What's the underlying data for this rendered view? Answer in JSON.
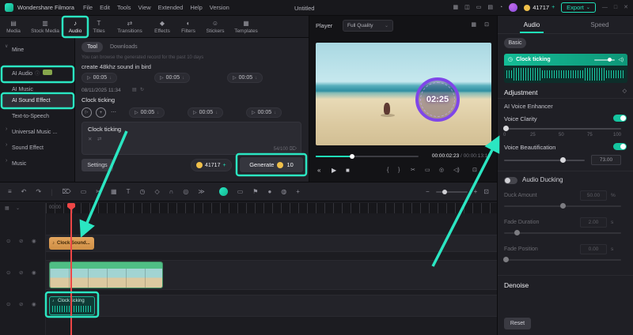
{
  "menubar": {
    "app": "Wondershare Filmora",
    "menus": [
      {
        "label": "File"
      },
      {
        "label": "Edit"
      },
      {
        "label": "Tools"
      },
      {
        "label": "View"
      },
      {
        "label": "Extended"
      },
      {
        "label": "Help"
      },
      {
        "label": "Version"
      }
    ],
    "title": "Untitled",
    "coins": "41717",
    "export_label": "Export"
  },
  "media_tabs": {
    "items": [
      {
        "label": "Media",
        "icon": "▤"
      },
      {
        "label": "Stock Media",
        "icon": "▥"
      },
      {
        "label": "Audio",
        "icon": "♪"
      },
      {
        "label": "Titles",
        "icon": "T"
      },
      {
        "label": "Transitions",
        "icon": "⇄"
      },
      {
        "label": "Effects",
        "icon": "◆"
      },
      {
        "label": "Filters",
        "icon": "◐"
      },
      {
        "label": "Stickers",
        "icon": "☺"
      },
      {
        "label": "Templates",
        "icon": "▦"
      }
    ]
  },
  "sidebar": {
    "items": [
      {
        "label": "Mine",
        "chevron": "∨"
      },
      {
        "label": "AI Audio",
        "chevron": ""
      },
      {
        "label": "AI Music",
        "chevron": ""
      },
      {
        "label": "AI Sound Effect",
        "chevron": ""
      },
      {
        "label": "Text-to-Speech",
        "chevron": ""
      },
      {
        "label": "Universal Music ...",
        "chevron": "›"
      },
      {
        "label": "Sound Effect",
        "chevron": "›"
      },
      {
        "label": "Music",
        "chevron": "›"
      }
    ]
  },
  "generator": {
    "tab_tool": "Tool",
    "tab_downloads": "Downloads",
    "hint": "You can browse the generated record for the past 10 days",
    "prompt": "create 48khz sound in bird",
    "durations": [
      {
        "time": "00:05"
      },
      {
        "time": "00:05"
      },
      {
        "time": "00:05"
      }
    ],
    "date": "08/11/2025 11:34",
    "record_name": "Clock ticking",
    "durations2": [
      {
        "time": "00:05"
      },
      {
        "time": "00:05"
      },
      {
        "time": "00:05"
      }
    ],
    "input_text": "Clock ticking",
    "char_count": "54/100",
    "settings_label": "Settings",
    "coins": "41717",
    "generate_label": "Generate",
    "generate_cost": "10"
  },
  "player": {
    "label": "Player",
    "quality": "Full Quality",
    "timer": "02:25",
    "time_current": "00:00:02:23",
    "time_sep": "/",
    "time_total": "00:00:13:10"
  },
  "properties": {
    "tab_audio": "Audio",
    "tab_speed": "Speed",
    "basic": "Basic",
    "clip_name": "Clock ticking",
    "adjustment": "Adjustment",
    "ai_voice": "AI Voice Enhancer",
    "voice_clarity": "Voice Clarity",
    "ticks": [
      {
        "v": "0"
      },
      {
        "v": "25"
      },
      {
        "v": "50"
      },
      {
        "v": "75"
      },
      {
        "v": "100"
      }
    ],
    "voice_beautification": "Voice Beautification",
    "vb_value": "73.00",
    "audio_ducking": "Audio Ducking",
    "rows": [
      {
        "label": "Duck Amount",
        "value": "50.00",
        "unit": "%"
      },
      {
        "label": "Fade Duration",
        "value": "2.00",
        "unit": "s"
      },
      {
        "label": "Fade Position",
        "value": "0.00",
        "unit": "s"
      }
    ],
    "denoise": "Denoise",
    "reset": "Reset"
  },
  "timeline": {
    "ruler_label": "00:00",
    "clip_sound": "Clock Sound...",
    "clip_audio": "Clock ticking"
  },
  "colors": {
    "accent": "#1fe0b8",
    "annotation": "#2be6c2",
    "playhead": "#ee4646",
    "coin": "#f0c04a"
  },
  "icons": {
    "caret": "⌄",
    "chev_r": "›",
    "chev_d": "∨",
    "play": "▶",
    "play_o": "▷",
    "stop": "■",
    "prev": "«",
    "plus": "+",
    "more": "⋯",
    "close": "✕",
    "refresh": "↻",
    "shuffle": "⇄",
    "download": "↓",
    "music": "♪",
    "speaker": "◁)",
    "list": "▤",
    "info": "ⓘ",
    "bell": "◔",
    "device": "◫",
    "diamond": "◇",
    "flag": "⚑",
    "frame": "▭",
    "snapshot": "◎",
    "expand": "⊡",
    "grid": "▦",
    "undo": "↶",
    "redo": "↷",
    "scissors": "✂",
    "trash": "⌦",
    "text": "T",
    "clock": "◷",
    "magnet": "∩",
    "chevrons": "≫",
    "layers": "≡",
    "zoom_out": "−",
    "zoom_in": "+",
    "lock": "⊙",
    "eye": "◉",
    "mute": "⊘",
    "record": "●",
    "mic": "◍",
    "brace_l": "{",
    "brace_r": "}",
    "win_min": "—",
    "win_max": "□",
    "win_close": "✕"
  }
}
